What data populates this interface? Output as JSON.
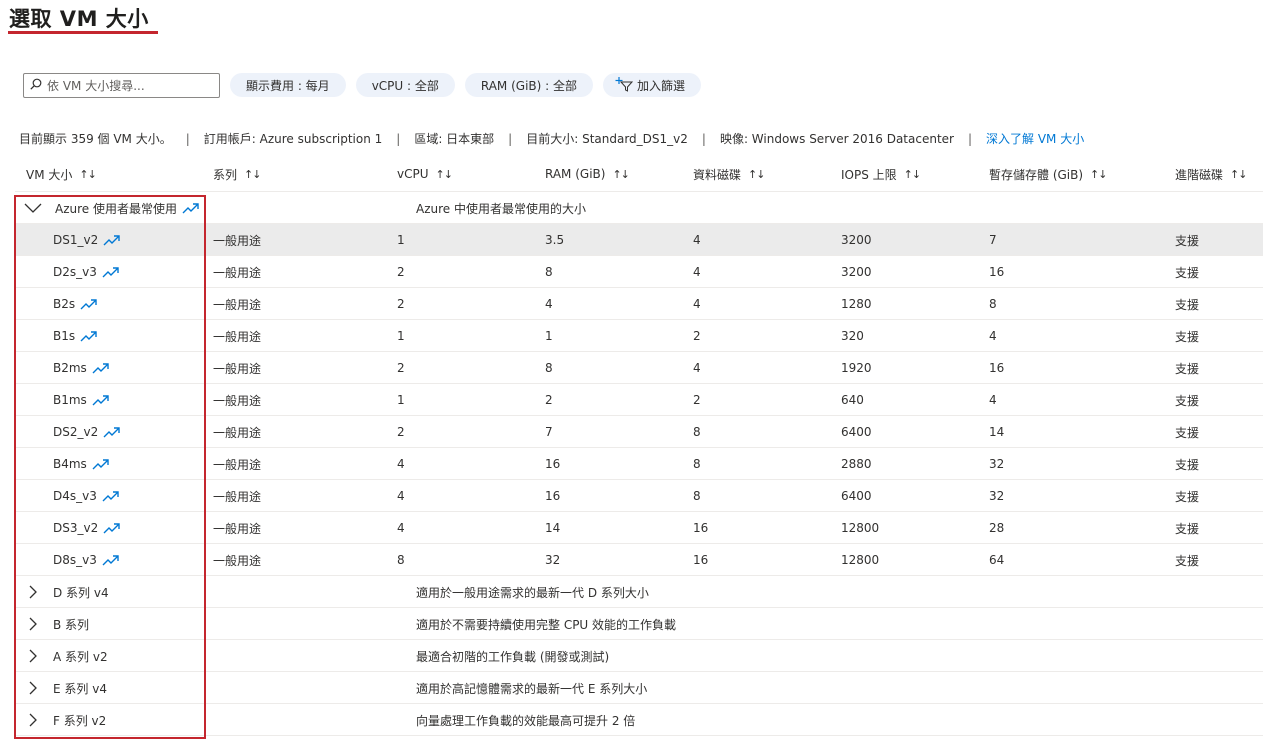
{
  "page": {
    "title": "選取 VM 大小"
  },
  "toolbar": {
    "search_placeholder": "依 VM 大小搜尋...",
    "cost_filter": "顯示費用 : 每月",
    "vcpu_filter": "vCPU : 全部",
    "ram_filter": "RAM (GiB) : 全部",
    "add_filter": "加入篩選"
  },
  "info": {
    "count": "目前顯示 359 個 VM 大小。",
    "subscription": "訂用帳戶: Azure subscription 1",
    "region": "區域: 日本東部",
    "current_size": "目前大小: Standard_DS1_v2",
    "image": "映像: Windows Server 2016 Datacenter",
    "learn_more": "深入了解 VM 大小"
  },
  "columns": {
    "size": "VM 大小",
    "family": "系列",
    "vcpu": "vCPU",
    "ram": "RAM (GiB)",
    "data_disks": "資料磁碟",
    "iops": "IOPS 上限",
    "temp_storage": "暫存儲存體 (GiB)",
    "premium_disk": "進階磁碟"
  },
  "popular_group": {
    "label": "Azure 使用者最常使用",
    "description": "Azure 中使用者最常使用的大小"
  },
  "rows": [
    {
      "size": "DS1_v2",
      "family": "一般用途",
      "vcpu": "1",
      "ram": "3.5",
      "disks": "4",
      "iops": "3200",
      "temp": "7",
      "premium": "支援"
    },
    {
      "size": "D2s_v3",
      "family": "一般用途",
      "vcpu": "2",
      "ram": "8",
      "disks": "4",
      "iops": "3200",
      "temp": "16",
      "premium": "支援"
    },
    {
      "size": "B2s",
      "family": "一般用途",
      "vcpu": "2",
      "ram": "4",
      "disks": "4",
      "iops": "1280",
      "temp": "8",
      "premium": "支援"
    },
    {
      "size": "B1s",
      "family": "一般用途",
      "vcpu": "1",
      "ram": "1",
      "disks": "2",
      "iops": "320",
      "temp": "4",
      "premium": "支援"
    },
    {
      "size": "B2ms",
      "family": "一般用途",
      "vcpu": "2",
      "ram": "8",
      "disks": "4",
      "iops": "1920",
      "temp": "16",
      "premium": "支援"
    },
    {
      "size": "B1ms",
      "family": "一般用途",
      "vcpu": "1",
      "ram": "2",
      "disks": "2",
      "iops": "640",
      "temp": "4",
      "premium": "支援"
    },
    {
      "size": "DS2_v2",
      "family": "一般用途",
      "vcpu": "2",
      "ram": "7",
      "disks": "8",
      "iops": "6400",
      "temp": "14",
      "premium": "支援"
    },
    {
      "size": "B4ms",
      "family": "一般用途",
      "vcpu": "4",
      "ram": "16",
      "disks": "8",
      "iops": "2880",
      "temp": "32",
      "premium": "支援"
    },
    {
      "size": "D4s_v3",
      "family": "一般用途",
      "vcpu": "4",
      "ram": "16",
      "disks": "8",
      "iops": "6400",
      "temp": "32",
      "premium": "支援"
    },
    {
      "size": "DS3_v2",
      "family": "一般用途",
      "vcpu": "4",
      "ram": "14",
      "disks": "16",
      "iops": "12800",
      "temp": "28",
      "premium": "支援"
    },
    {
      "size": "D8s_v3",
      "family": "一般用途",
      "vcpu": "8",
      "ram": "32",
      "disks": "16",
      "iops": "12800",
      "temp": "64",
      "premium": "支援"
    }
  ],
  "groups": [
    {
      "label": "D 系列 v4",
      "description": "適用於一般用途需求的最新一代 D 系列大小"
    },
    {
      "label": "B 系列",
      "description": "適用於不需要持續使用完整 CPU 效能的工作負載"
    },
    {
      "label": "A 系列 v2",
      "description": "最適合初階的工作負載 (開發或測試)"
    },
    {
      "label": "E 系列 v4",
      "description": "適用於高記憶體需求的最新一代 E 系列大小"
    },
    {
      "label": "F 系列 v2",
      "description": "向量處理工作負載的效能最高可提升 2 倍"
    }
  ],
  "colors": {
    "accent": "#0078d4",
    "highlight_box": "#c4262e",
    "pill_bg": "#edf2fa",
    "selected_row": "#ebebeb"
  },
  "icons": {
    "search": "search-icon",
    "trend": "trending-up-icon",
    "filter": "add-filter-icon",
    "expand": "chevron-right-icon",
    "collapse": "chevron-down-icon"
  }
}
